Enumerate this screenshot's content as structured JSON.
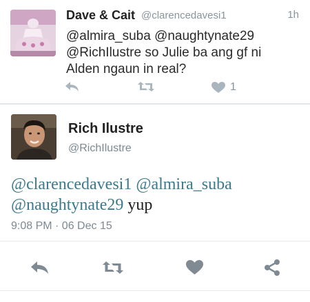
{
  "tweet": {
    "display_name": "Dave & Cait",
    "handle": "@clarencedavesi1",
    "time": "1h",
    "text_lines": [
      "@almira_suba @naughtynate29",
      "@RichIlustre so Julie ba ang gf ni",
      "Alden ngaun in real?"
    ],
    "like_count": "1",
    "icons": [
      "reply-icon",
      "retweet-icon",
      "heart-icon"
    ],
    "colors": {
      "icon": "#aab5bd",
      "muted_text": "#8a949c"
    }
  },
  "reply": {
    "display_name": "Rich Ilustre",
    "handle": "@RichIlustre",
    "mention_1": "@clarencedavesi1",
    "mention_2": "@almira_suba",
    "mention_3": "@naughtynate29",
    "text_tail": "yup",
    "timestamp": "9:08 PM · 06 Dec 15",
    "icons": [
      "reply-icon",
      "retweet-icon",
      "heart-icon",
      "share-icon"
    ],
    "colors": {
      "mention": "#3a7a8c",
      "icon": "#7f8a93"
    }
  }
}
